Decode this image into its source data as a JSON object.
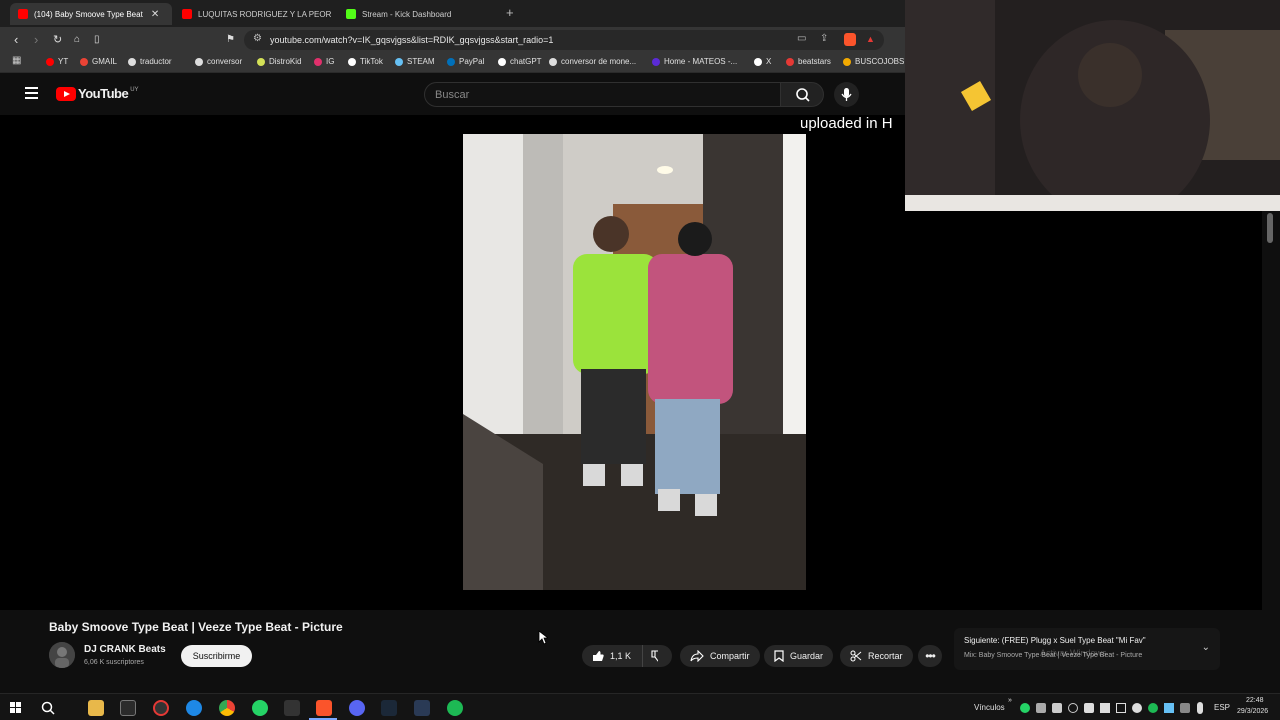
{
  "browser": {
    "tabs": [
      {
        "label": "(104) Baby Smoove Type Beat",
        "favicon_color": "#ff0000",
        "active": true
      },
      {
        "label": "LUQUITAS RODRIGUEZ Y LA PEOR EN",
        "favicon_color": "#ff0000",
        "active": false
      },
      {
        "label": "Stream - Kick Dashboard",
        "favicon_color": "#53fc18",
        "active": false
      }
    ],
    "url": "youtube.com/watch?v=IK_gqsvjgss&list=RDIK_gqsvjgss&start_radio=1",
    "bookmarks": [
      {
        "label": "YT",
        "color": "#ff0000"
      },
      {
        "label": "GMAIL",
        "color": "#ea4335"
      },
      {
        "label": "traductor",
        "color": "#dddddd"
      },
      {
        "label": "conversor",
        "color": "#dddddd"
      },
      {
        "label": "DistroKid",
        "color": "#d4e157"
      },
      {
        "label": "IG",
        "color": "#e1306c"
      },
      {
        "label": "TikTok",
        "color": "#ffffff"
      },
      {
        "label": "STEAM",
        "color": "#1b2838"
      },
      {
        "label": "PayPal",
        "color": "#0070ba"
      },
      {
        "label": "chatGPT",
        "color": "#ffffff"
      },
      {
        "label": "conversor de mone...",
        "color": "#dddddd"
      },
      {
        "label": "Home - MATEOS -...",
        "color": "#5b2bd6"
      },
      {
        "label": "X",
        "color": "#ffffff"
      },
      {
        "label": "beatstars",
        "color": "#e53935"
      },
      {
        "label": "BUSCOJOBS",
        "color": "#f2a900"
      }
    ]
  },
  "youtube": {
    "logo_text": "YouTube",
    "country_code": "UY",
    "search_placeholder": "Buscar",
    "overlay_text": "uploaded in H",
    "video_title": "Baby Smoove Type Beat | Veeze Type Beat - Picture",
    "channel_name": "DJ CRANK Beats",
    "subscribers": "6,06 K suscriptores",
    "subscribe_label": "Suscribirme",
    "likes": "1,1 K",
    "share_label": "Compartir",
    "save_label": "Guardar",
    "clip_label": "Recortar",
    "next_line1": "Siguiente: (FREE) Plugg x Suel Type Beat \"Mi Fav\"",
    "next_line2": "Mix: Baby Smoove Type Beat | Veeze Type Beat - Picture",
    "windows_watermark": "Activar Windows"
  },
  "taskbar": {
    "links_label": "Vínculos",
    "language": "ESP",
    "time": "22:48",
    "date": "29/3/2026"
  }
}
